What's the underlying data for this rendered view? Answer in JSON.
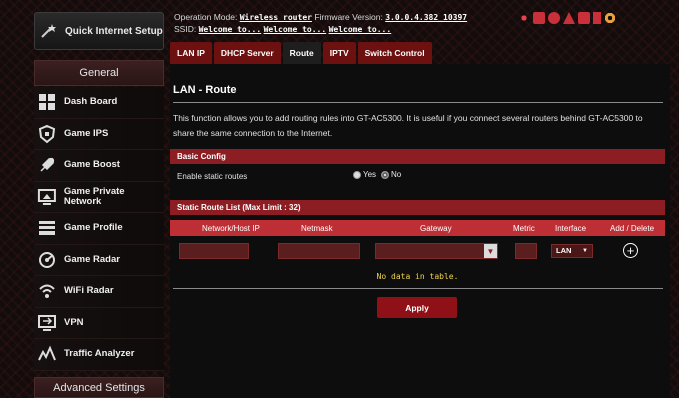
{
  "sidebar": {
    "quick_setup_label": "Quick Internet Setup",
    "general_label": "General",
    "advanced_label": "Advanced Settings",
    "items": [
      {
        "label": "Dash Board",
        "icon": "dashboard-icon"
      },
      {
        "label": "Game IPS",
        "icon": "shield-icon"
      },
      {
        "label": "Game Boost",
        "icon": "rocket-icon"
      },
      {
        "label": "Game Private Network",
        "icon": "monitor-icon"
      },
      {
        "label": "Game Profile",
        "icon": "profile-icon"
      },
      {
        "label": "Game Radar",
        "icon": "radar-icon"
      },
      {
        "label": "WiFi Radar",
        "icon": "wifi-radar-icon"
      },
      {
        "label": "VPN",
        "icon": "vpn-icon"
      },
      {
        "label": "Traffic Analyzer",
        "icon": "traffic-icon"
      }
    ]
  },
  "header": {
    "op_mode_label": "Operation Mode:",
    "op_mode_value": "Wireless router",
    "firmware_label": "Firmware Version:",
    "firmware_value": "3.0.0.4.382_10397",
    "ssid_label": "SSID:",
    "ssids": [
      "Welcome to...",
      "Welcome to...",
      "Welcome to..."
    ]
  },
  "tabs": [
    {
      "label": "LAN IP",
      "active": false
    },
    {
      "label": "DHCP Server",
      "active": false
    },
    {
      "label": "Route",
      "active": true
    },
    {
      "label": "IPTV",
      "active": false
    },
    {
      "label": "Switch Control",
      "active": false
    }
  ],
  "page": {
    "title": "LAN - Route",
    "description": "This function allows you to add routing rules into GT-AC5300. It is useful if you connect several routers behind GT-AC5300 to share the same connection to the Internet."
  },
  "basic_config": {
    "header": "Basic Config",
    "static_routes_label": "Enable static routes",
    "yes_label": "Yes",
    "no_label": "No",
    "selected": "No"
  },
  "route_list": {
    "header": "Static Route List (Max Limit : 32)",
    "columns": [
      "Network/Host IP",
      "Netmask",
      "Gateway",
      "Metric",
      "Interface",
      "Add / Delete"
    ],
    "interface_value": "LAN",
    "empty_text": "No data in table."
  },
  "apply_label": "Apply",
  "colors": {
    "accent": "#8c1d22",
    "header_red": "#bd2f35",
    "empty_text": "#f1d44b"
  }
}
